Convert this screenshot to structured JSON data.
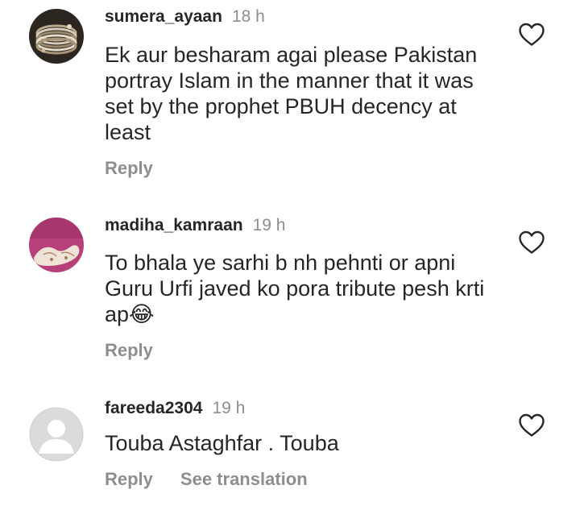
{
  "comments": [
    {
      "username": "sumera_ayaan",
      "time": "18 h",
      "text": "Ek aur besharam agai please Pakistan portray Islam in the manner that it was set by the prophet PBUH decency at least",
      "reply": "Reply",
      "avatar": "bangles-avatar",
      "like_icon": "heart-outline-icon"
    },
    {
      "username": "madiha_kamraan",
      "time": "19 h",
      "text": "To bhala ye sarhi b nh pehnti or apni Guru Urfi javed ko pora tribute pesh krti ap😂",
      "reply": "Reply",
      "avatar": "henna-hands-avatar",
      "like_icon": "heart-outline-icon"
    },
    {
      "username": "fareeda2304",
      "time": "19 h",
      "text": "Touba Astaghfar . Touba",
      "reply": "Reply",
      "see_translation": "See translation",
      "avatar": "default-avatar",
      "like_icon": "heart-outline-icon"
    }
  ],
  "colors": {
    "text": "#262626",
    "muted": "#8e8e8e",
    "background": "#ffffff"
  }
}
